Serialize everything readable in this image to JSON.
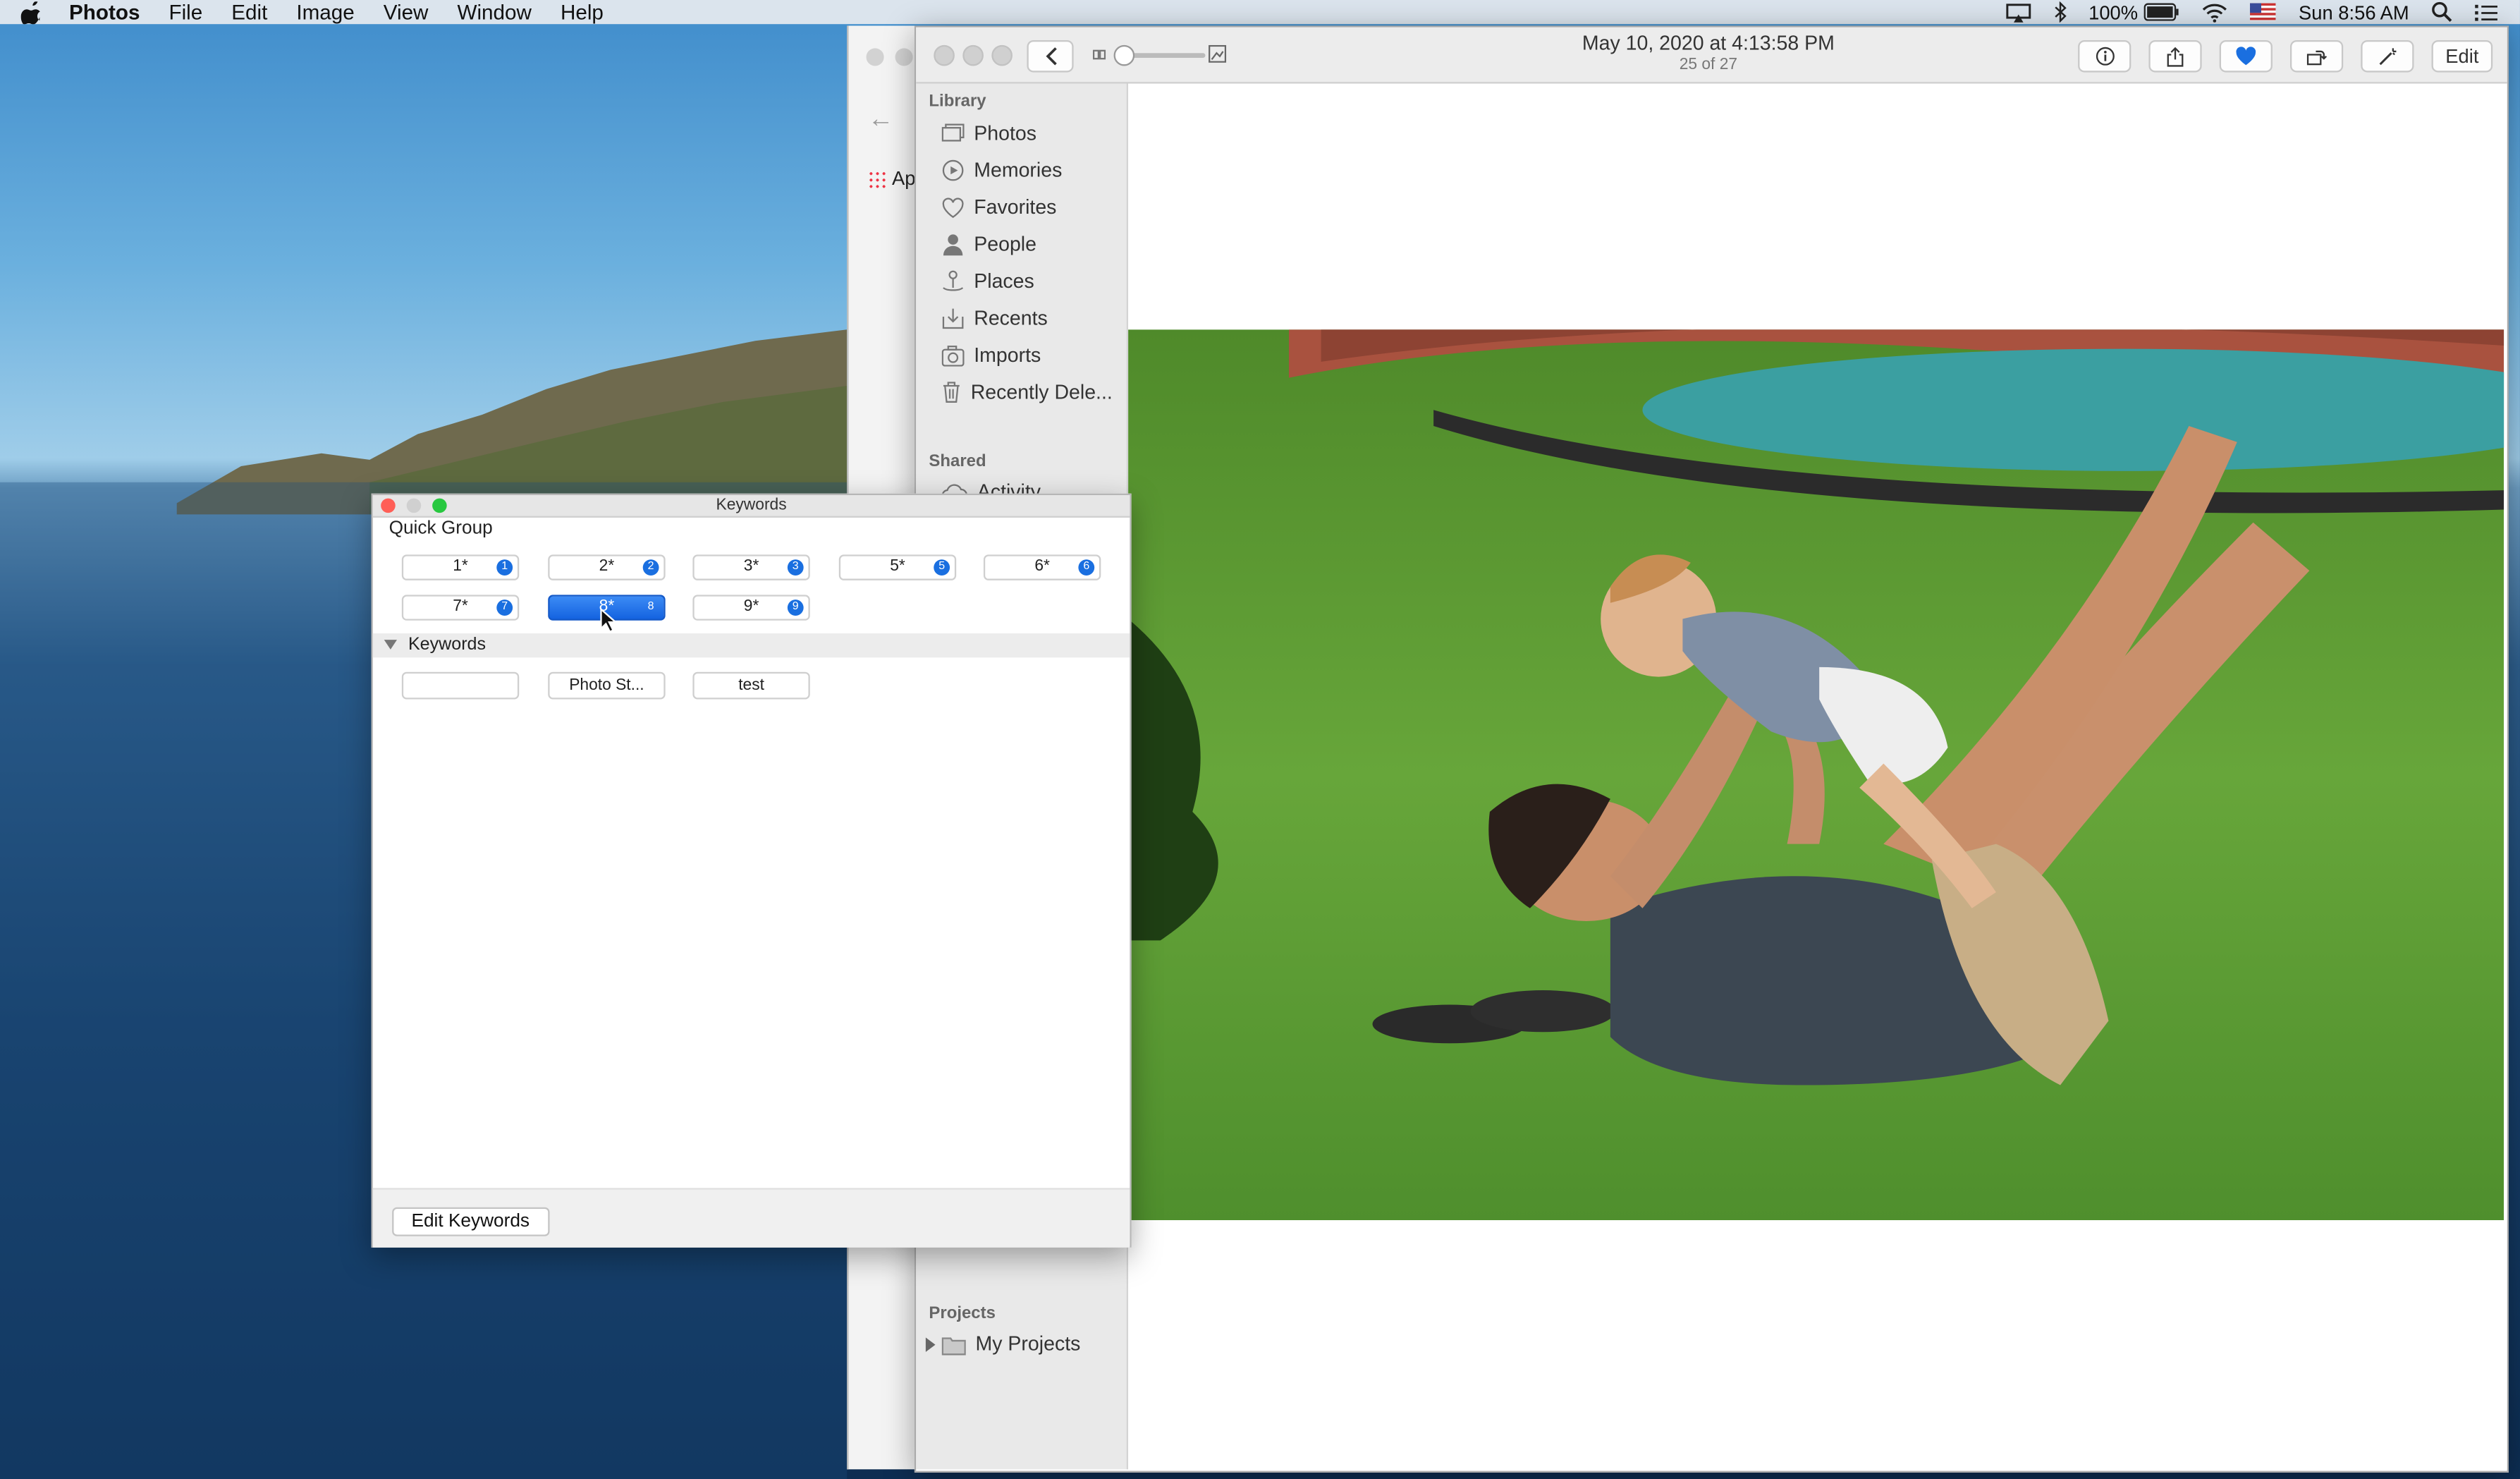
{
  "menubar": {
    "app_name": "Photos",
    "items": [
      "File",
      "Edit",
      "Image",
      "View",
      "Window",
      "Help"
    ],
    "battery": "100%",
    "clock": "Sun 8:56 AM"
  },
  "back_window": {
    "apps_label": "Ap"
  },
  "photos": {
    "title_date": "May 10, 2020 at 4:13:58 PM",
    "title_count": "25 of 27",
    "edit_label": "Edit",
    "sidebar": {
      "library_header": "Library",
      "library_items": [
        "Photos",
        "Memories",
        "Favorites",
        "People",
        "Places",
        "Recents",
        "Imports",
        "Recently Dele..."
      ],
      "shared_header": "Shared",
      "shared_items": [
        "Activity"
      ],
      "projects_header": "Projects",
      "projects_items": [
        "My Projects"
      ]
    }
  },
  "keywords_panel": {
    "title": "Keywords",
    "quick_group_label": "Quick Group",
    "quick_group": [
      {
        "label": "1*",
        "badge": "1"
      },
      {
        "label": "2*",
        "badge": "2"
      },
      {
        "label": "3*",
        "badge": "3"
      },
      {
        "label": "5*",
        "badge": "5"
      },
      {
        "label": "6*",
        "badge": "6"
      },
      {
        "label": "7*",
        "badge": "7"
      },
      {
        "label": "8*",
        "badge": "8"
      },
      {
        "label": "9*",
        "badge": "9"
      }
    ],
    "keywords_section_label": "Keywords",
    "keywords": [
      "",
      "Photo St...",
      "test"
    ],
    "edit_button": "Edit Keywords"
  },
  "colors": {
    "accent": "#1a6fe0",
    "favorite_heart": "#1a6fe0",
    "close": "#ff5f57",
    "minimize": "#ffbd2e",
    "zoom": "#28c840"
  }
}
